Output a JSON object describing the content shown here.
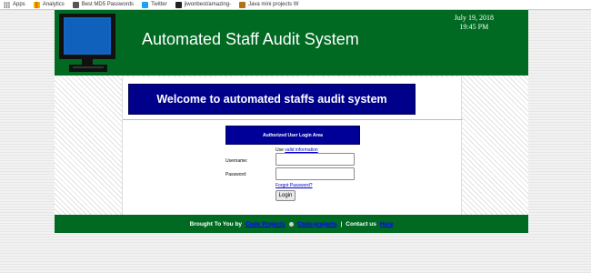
{
  "bookmarks": [
    {
      "label": "Apps",
      "icon": "apps-icon"
    },
    {
      "label": "Analytics",
      "icon": "analytics-icon"
    },
    {
      "label": "Best MD5 Passwords",
      "icon": "md5-icon"
    },
    {
      "label": "Twitter",
      "icon": "twitter-icon"
    },
    {
      "label": "jiwonbest/amazing-",
      "icon": "github-icon"
    },
    {
      "label": "Java mini projects W",
      "icon": "java-icon"
    }
  ],
  "header": {
    "title": "Automated Staff Audit System",
    "date": "July 19, 2018",
    "time": "19:45 PM",
    "color": "#006a22"
  },
  "welcome": "Welcome to automated staffs audit system",
  "login": {
    "heading": "Authorized User Login Area",
    "use_prefix": "Use",
    "use_link": "valid information",
    "username_label": "Username:",
    "password_label": "Password:",
    "username_value": "",
    "password_value": "",
    "forgot_link": "Forgot Password?",
    "button_label": "Login"
  },
  "footer": {
    "brought": "Brought To You by",
    "link1": "Code Projects",
    "link2": "Code-projects",
    "separator": "|",
    "contact": "Contact us",
    "here_link": "Here"
  },
  "colors": {
    "header_green": "#006a22",
    "welcome_blue": "#00008b",
    "login_blue": "#000099"
  }
}
